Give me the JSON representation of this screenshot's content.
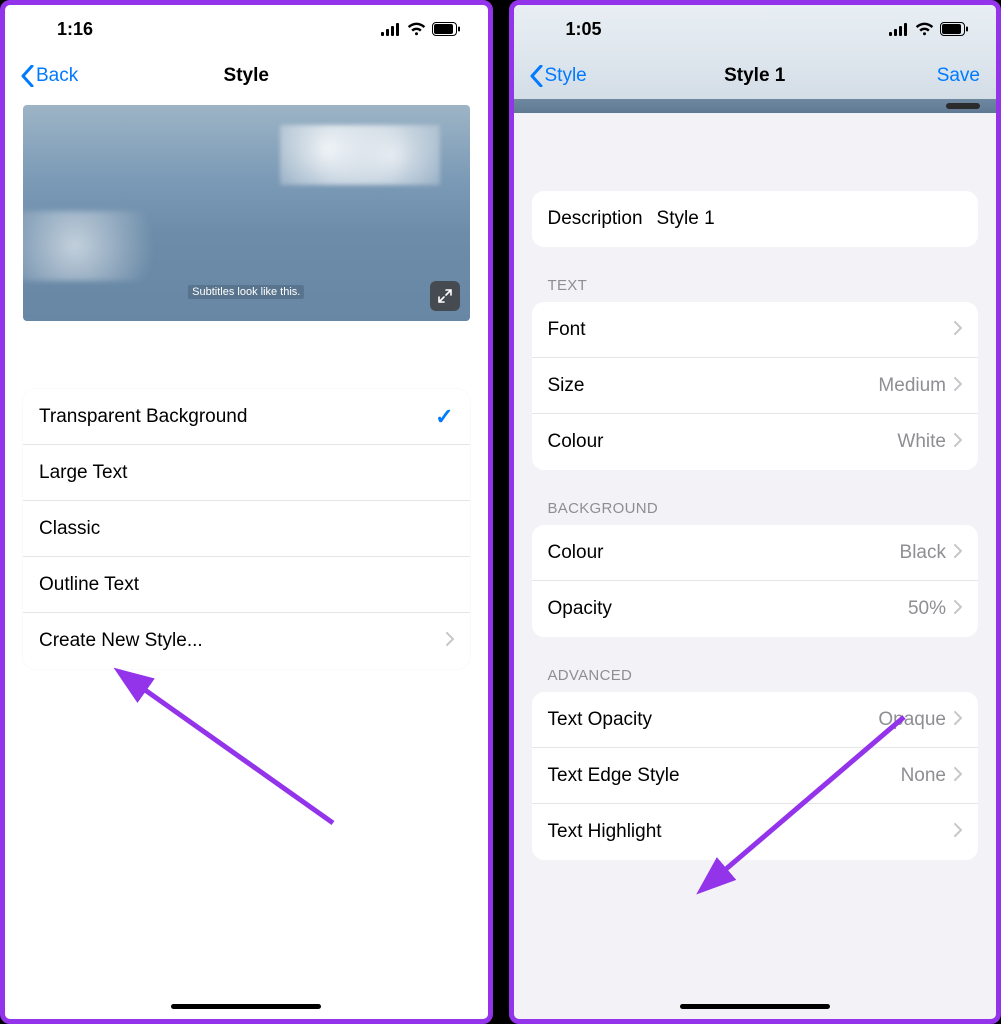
{
  "left": {
    "status_time": "1:16",
    "nav": {
      "back": "Back",
      "title": "Style"
    },
    "subtitle_sample": "Subtitles look like this.",
    "styles": [
      {
        "label": "Transparent Background",
        "checked": true
      },
      {
        "label": "Large Text",
        "checked": false
      },
      {
        "label": "Classic",
        "checked": false
      },
      {
        "label": "Outline Text",
        "checked": false
      }
    ],
    "create_label": "Create New Style..."
  },
  "right": {
    "status_time": "1:05",
    "nav": {
      "back": "Style",
      "title": "Style 1",
      "save": "Save"
    },
    "description": {
      "label": "Description",
      "value": "Style 1"
    },
    "sections": {
      "text": {
        "header": "TEXT",
        "rows": [
          {
            "label": "Font",
            "value": ""
          },
          {
            "label": "Size",
            "value": "Medium"
          },
          {
            "label": "Colour",
            "value": "White"
          }
        ]
      },
      "background": {
        "header": "BACKGROUND",
        "rows": [
          {
            "label": "Colour",
            "value": "Black"
          },
          {
            "label": "Opacity",
            "value": "50%"
          }
        ]
      },
      "advanced": {
        "header": "ADVANCED",
        "rows": [
          {
            "label": "Text Opacity",
            "value": "Opaque"
          },
          {
            "label": "Text Edge Style",
            "value": "None"
          },
          {
            "label": "Text Highlight",
            "value": ""
          }
        ]
      }
    }
  }
}
